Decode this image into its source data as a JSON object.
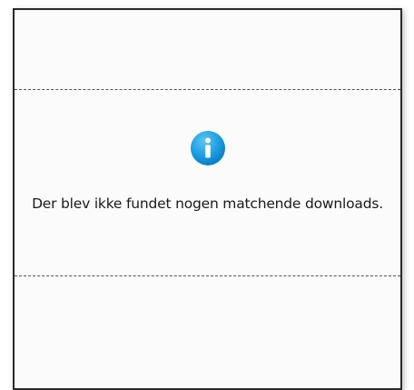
{
  "empty_state": {
    "message": "Der blev ikke fundet nogen matchende downloads.",
    "icon": "info-icon",
    "icon_color": "#1a9be0"
  }
}
